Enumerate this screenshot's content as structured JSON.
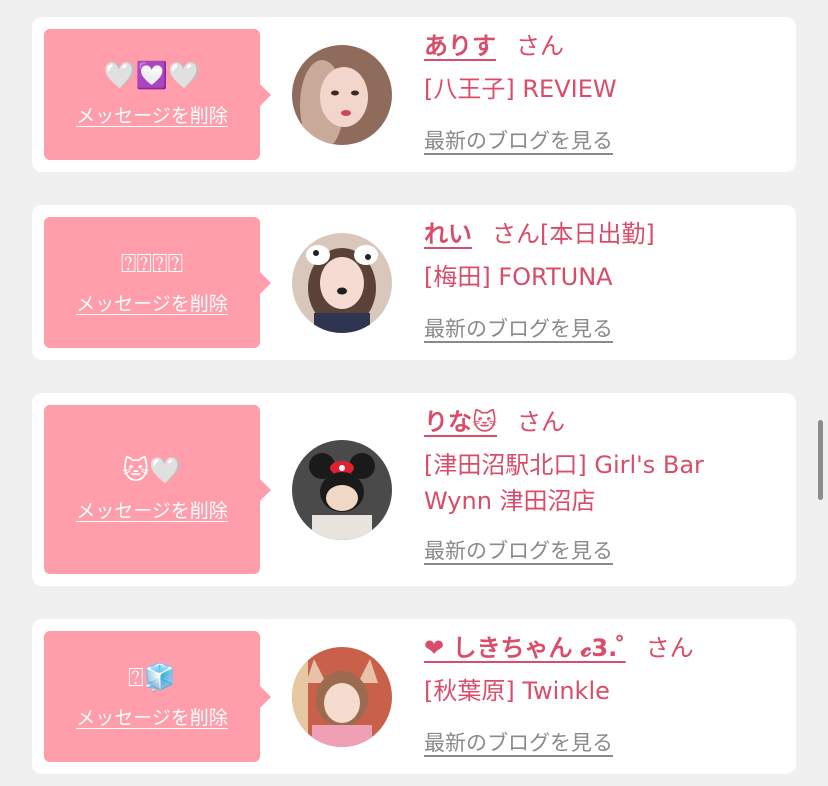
{
  "cards": [
    {
      "emoji": "🤍💟🤍",
      "delete_label": "メッセージを削除",
      "name": "ありす",
      "suffix": "さん",
      "shop": "[八王子] REVIEW",
      "blog_label": "最新のブログを見る"
    },
    {
      "emoji": "⍰⍰⍰⍰",
      "delete_label": "メッセージを削除",
      "name": "れい",
      "suffix": "さん[本日出勤]",
      "shop": "[梅田] FORTUNA",
      "blog_label": "最新のブログを見る"
    },
    {
      "emoji": "🐱🤍",
      "delete_label": "メッセージを削除",
      "name": "りな🐱",
      "suffix": "さん",
      "shop": "[津田沼駅北口] Girl's Bar Wynn 津田沼店",
      "blog_label": "最新のブログを見る"
    },
    {
      "emoji": "⍰🧊",
      "delete_label": "メッセージを削除",
      "name": "❤ しきちゃん 𝓬3. ̊",
      "suffix": "さん",
      "shop": "[秋葉原] Twinkle",
      "blog_label": "最新のブログを見る"
    }
  ],
  "colors": {
    "accent": "#d94c6a",
    "bubble": "#ff9eaa",
    "background": "#f0f0f0",
    "card": "#ffffff",
    "link_gray": "#8a8a8a"
  }
}
